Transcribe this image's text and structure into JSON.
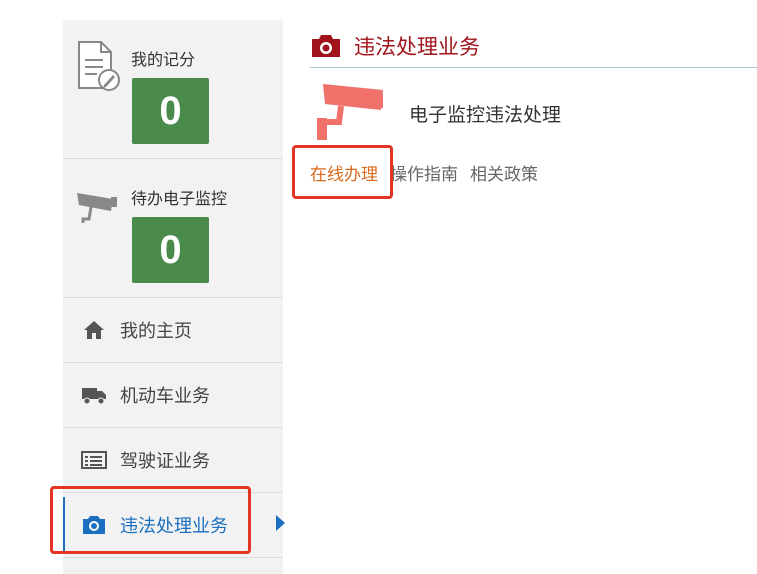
{
  "sidebar": {
    "score_card": {
      "label": "我的记分",
      "count": "0",
      "icon": "document-edit-icon"
    },
    "monitor_card": {
      "label": "待办电子监控",
      "count": "0",
      "icon": "surveillance-camera-icon"
    },
    "nav": [
      {
        "label": "我的主页",
        "icon": "home-icon"
      },
      {
        "label": "机动车业务",
        "icon": "truck-icon"
      },
      {
        "label": "驾驶证业务",
        "icon": "license-card-icon"
      },
      {
        "label": "违法处理业务",
        "icon": "camera-icon",
        "active": true
      }
    ]
  },
  "main": {
    "title": "违法处理业务",
    "title_icon": "camera-icon",
    "service": {
      "name": "电子监控违法处理",
      "icon": "surveillance-camera-icon"
    },
    "tabs": [
      {
        "label": "在线办理",
        "selected": true
      },
      {
        "label": "操作指南"
      },
      {
        "label": "相关政策"
      }
    ]
  },
  "colors": {
    "accent_blue": "#1a6fc0",
    "title_red": "#a0141b",
    "count_green": "#4a8a4a",
    "tab_orange": "#d9691b",
    "highlight_red": "#e53326"
  }
}
